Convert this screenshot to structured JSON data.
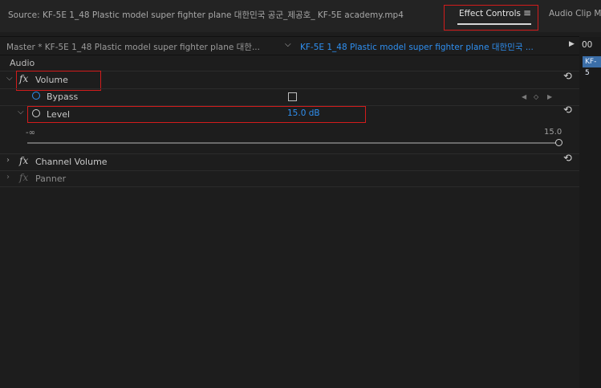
{
  "tabs": {
    "source": "Source: KF-5E  1_48 Plastic model  super fighter plane 대한민국 공군_제공호_ KF-5E academy.mp4",
    "effect_controls": "Effect Controls",
    "menu_glyph": "≡",
    "audio_clip": "Audio Clip M"
  },
  "clip_header": {
    "master": "Master * KF-5E  1_48 Plastic model  super fighter plane 대한...",
    "clip": "KF-5E  1_48 Plastic model  super fighter plane 대한민국 ...",
    "timecode": "00",
    "timeline_badge": "KF-5"
  },
  "section": {
    "audio": "Audio"
  },
  "effects": {
    "volume": {
      "fx": "fx",
      "label": "Volume"
    },
    "bypass": {
      "label": "Bypass",
      "checked": false
    },
    "level": {
      "label": "Level",
      "value": "15.0 dB"
    },
    "slider": {
      "min_label": "-∞",
      "max_label": "15.0",
      "fraction": 1.0
    },
    "channel_volume": {
      "fx": "fx",
      "label": "Channel Volume"
    },
    "panner": {
      "fx": "fx",
      "label": "Panner"
    }
  },
  "icons": [
    "menu-icon",
    "play-icon",
    "chevron-down-icon",
    "chevron-right-icon",
    "fx-icon",
    "stopwatch-icon",
    "reset-icon",
    "keyframe-prev-icon",
    "keyframe-add-icon",
    "keyframe-next-icon"
  ],
  "colors": {
    "accent": "#2f8ff0",
    "highlight": "#d21c1c",
    "bg": "#1d1d1d"
  }
}
